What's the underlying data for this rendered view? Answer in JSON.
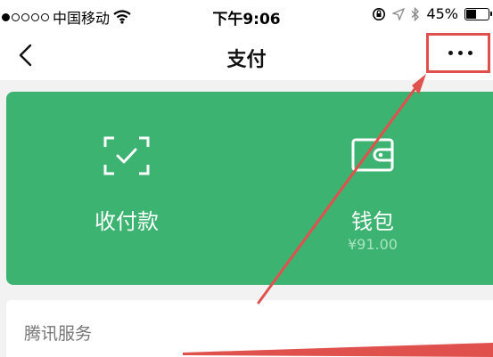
{
  "status_bar": {
    "carrier": "中国移动",
    "time": "下午9:06",
    "battery": "45%",
    "battery_level": 0.45
  },
  "nav": {
    "title": "支付"
  },
  "panel": {
    "collect_label": "收付款",
    "wallet_label": "钱包",
    "wallet_balance": "¥91.00"
  },
  "services": {
    "title": "腾讯服务"
  },
  "colors": {
    "accent_green": "#3cb371",
    "highlight_red": "#e0514e"
  }
}
